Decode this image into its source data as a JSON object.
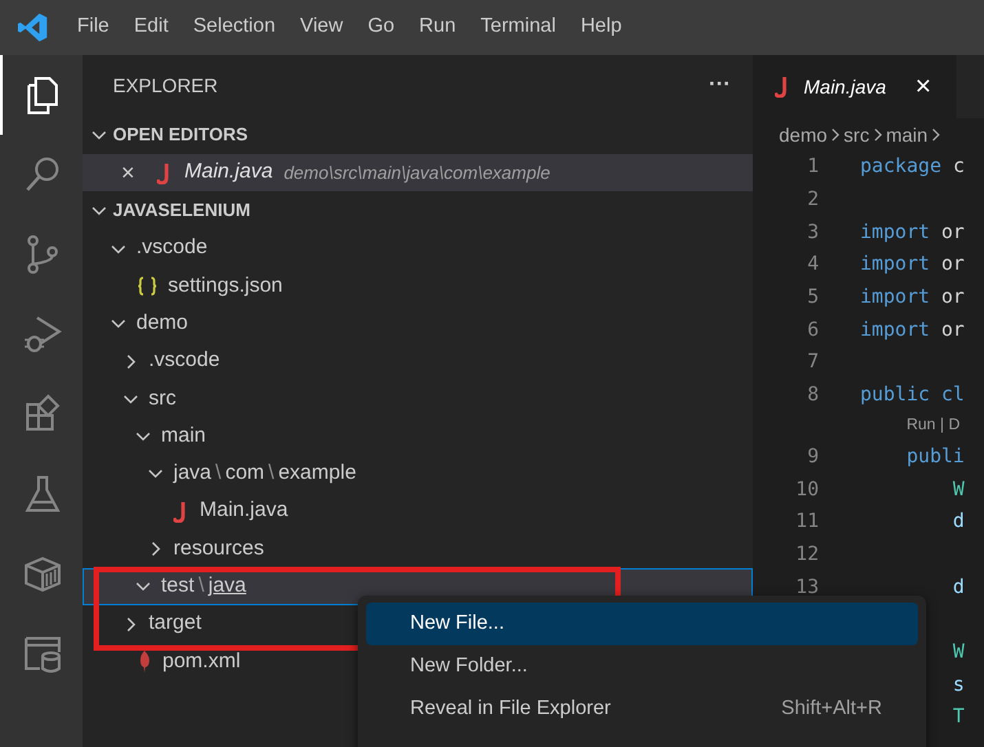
{
  "menu_bar": [
    "File",
    "Edit",
    "Selection",
    "View",
    "Go",
    "Run",
    "Terminal",
    "Help"
  ],
  "activity_bar": [
    {
      "kind": "explorer",
      "selected": true
    },
    {
      "kind": "search",
      "selected": false
    },
    {
      "kind": "source-control",
      "selected": false
    },
    {
      "kind": "run-debug",
      "selected": false
    },
    {
      "kind": "extensions",
      "selected": false
    },
    {
      "kind": "testing",
      "selected": false
    },
    {
      "kind": "container",
      "selected": false
    },
    {
      "kind": "database",
      "selected": false
    }
  ],
  "sidebar": {
    "title": "EXPLORER",
    "more": "···",
    "open_editors": {
      "title": "OPEN EDITORS",
      "expanded": true,
      "items": [
        {
          "close": "×",
          "name": "Main.java",
          "path": "demo\\src\\main\\java\\com\\example",
          "kind": "java",
          "selected": true
        }
      ]
    },
    "workspace": {
      "title": "JAVASELENIUM",
      "expanded": true,
      "tree": [
        {
          "kind": "folder",
          "segments": [
            ".vscode"
          ],
          "expanded": true,
          "selected": false,
          "children": [
            {
              "kind": "json",
              "segments": [
                "settings.json"
              ],
              "selected": false
            }
          ]
        },
        {
          "kind": "folder",
          "segments": [
            "demo"
          ],
          "expanded": true,
          "selected": false,
          "children": [
            {
              "kind": "folder",
              "segments": [
                ".vscode"
              ],
              "expanded": false,
              "selected": false
            },
            {
              "kind": "folder",
              "segments": [
                "src"
              ],
              "expanded": true,
              "selected": false,
              "children": [
                {
                  "kind": "folder",
                  "segments": [
                    "main"
                  ],
                  "expanded": true,
                  "selected": false,
                  "children": [
                    {
                      "kind": "folder",
                      "segments": [
                        "java",
                        "\\",
                        "com",
                        "\\",
                        "example"
                      ],
                      "expanded": true,
                      "selected": false,
                      "children": [
                        {
                          "kind": "java",
                          "segments": [
                            "Main.java"
                          ],
                          "selected": false
                        }
                      ]
                    },
                    {
                      "kind": "folder",
                      "segments": [
                        "resources"
                      ],
                      "expanded": false,
                      "selected": false
                    }
                  ]
                },
                {
                  "kind": "folder",
                  "segments": [
                    "test",
                    "\\",
                    "java"
                  ],
                  "expanded": true,
                  "selected": true,
                  "underline_last": true
                }
              ]
            },
            {
              "kind": "folder",
              "segments": [
                "target"
              ],
              "expanded": false,
              "selected": false
            },
            {
              "kind": "maven",
              "segments": [
                "pom.xml"
              ],
              "selected": false
            }
          ]
        }
      ]
    }
  },
  "editor": {
    "tabs": [
      {
        "kind": "java",
        "name": "Main.java",
        "close": "×",
        "selected": true
      }
    ],
    "breadcrumb": [
      "demo",
      "src",
      "main"
    ],
    "lines": [
      {
        "kind": "code",
        "number": "1",
        "tokens": [
          {
            "kind": "keyword",
            "text": "package"
          },
          {
            "kind": "plain",
            "text": " c"
          }
        ]
      },
      {
        "kind": "code",
        "number": "2"
      },
      {
        "kind": "code",
        "number": "3",
        "tokens": [
          {
            "kind": "keyword",
            "text": "import"
          },
          {
            "kind": "plain",
            "text": " or"
          }
        ]
      },
      {
        "kind": "code",
        "number": "4",
        "tokens": [
          {
            "kind": "keyword",
            "text": "import"
          },
          {
            "kind": "plain",
            "text": " or"
          }
        ]
      },
      {
        "kind": "code",
        "number": "5",
        "tokens": [
          {
            "kind": "keyword",
            "text": "import"
          },
          {
            "kind": "plain",
            "text": " or"
          }
        ]
      },
      {
        "kind": "code",
        "number": "6",
        "tokens": [
          {
            "kind": "keyword",
            "text": "import"
          },
          {
            "kind": "plain",
            "text": " or"
          }
        ]
      },
      {
        "kind": "code",
        "number": "7"
      },
      {
        "kind": "code",
        "number": "8",
        "tokens": [
          {
            "kind": "keyword",
            "text": "public"
          },
          {
            "kind": "keyword",
            "text": " cl"
          }
        ]
      },
      {
        "kind": "code",
        "number": "9",
        "codelens": "Run | D",
        "tokens": [
          {
            "kind": "keyword",
            "text": "    publi"
          }
        ]
      },
      {
        "kind": "code",
        "number": "10",
        "tokens": [
          {
            "kind": "type",
            "text": "        W"
          }
        ]
      },
      {
        "kind": "code",
        "number": "11",
        "tokens": [
          {
            "kind": "variable",
            "text": "        d"
          }
        ]
      },
      {
        "kind": "code",
        "number": "12"
      },
      {
        "kind": "code",
        "number": "13",
        "tokens": [
          {
            "kind": "variable",
            "text": "        d"
          }
        ]
      },
      {
        "kind": "blank"
      },
      {
        "kind": "code",
        "tokens": [
          {
            "kind": "type",
            "text": "        W"
          }
        ]
      },
      {
        "kind": "code",
        "tokens": [
          {
            "kind": "variable",
            "text": "        s"
          }
        ]
      },
      {
        "kind": "code",
        "tokens": [
          {
            "kind": "type",
            "text": "        T"
          }
        ]
      }
    ]
  },
  "context_menu": [
    {
      "label": "New File...",
      "selected": true
    },
    {
      "label": "New Folder...",
      "selected": false
    },
    {
      "label": "Reveal in File Explorer",
      "shortcut": "Shift+Alt+R",
      "selected": false
    }
  ]
}
